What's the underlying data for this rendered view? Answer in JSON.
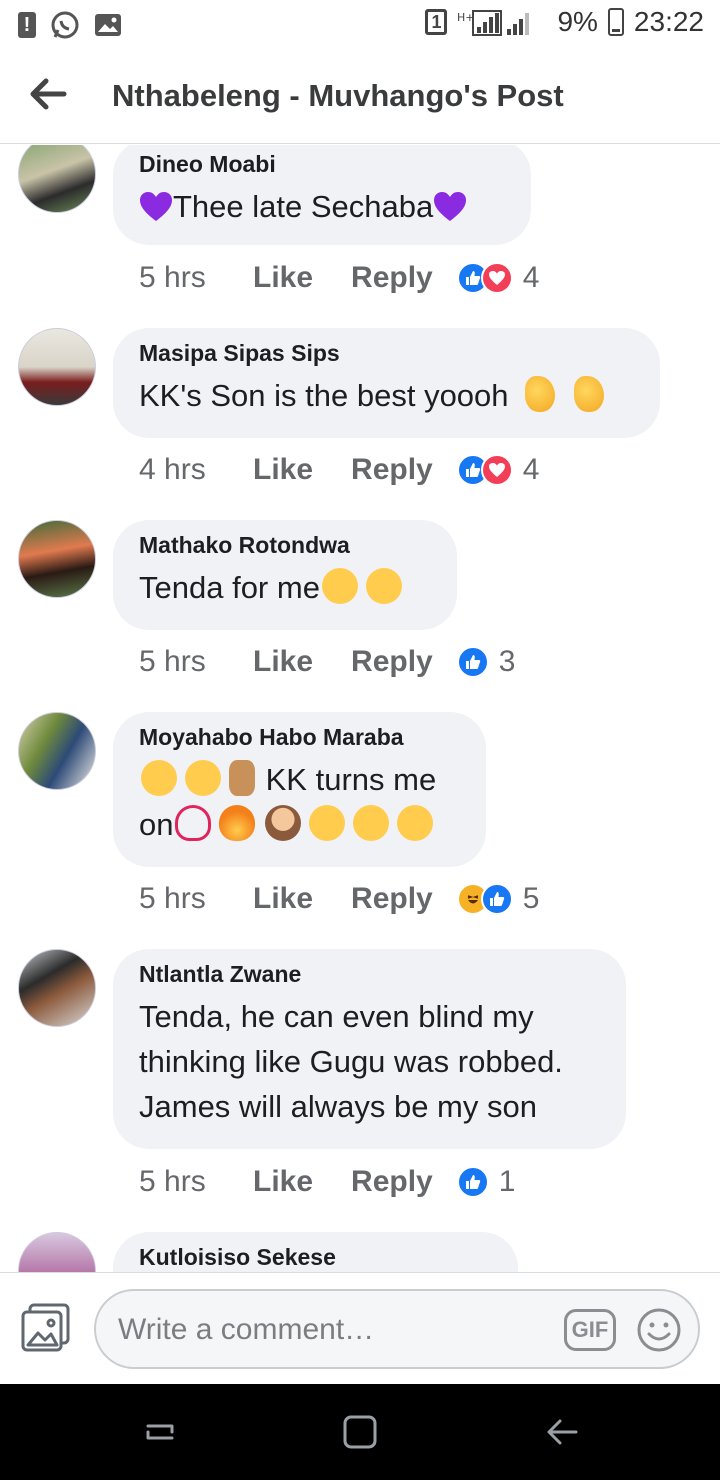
{
  "status_bar": {
    "notification_badge": "1",
    "battery": "9%",
    "time": "23:22"
  },
  "header": {
    "title": "Nthabeleng - Muvhango's Post"
  },
  "comments": [
    {
      "name": "Dineo Moabi",
      "text": "Thee late Sechaba",
      "time": "5 hrs",
      "like": "Like",
      "reply": "Reply",
      "reaction_icons": [
        "like",
        "love"
      ],
      "reaction_count": "4"
    },
    {
      "name": "Masipa Sipas Sips",
      "text": "KK's Son is the best yoooh",
      "time": "4 hrs",
      "like": "Like",
      "reply": "Reply",
      "reaction_icons": [
        "like",
        "love"
      ],
      "reaction_count": "4"
    },
    {
      "name": "Mathako Rotondwa",
      "text": "Tenda for me",
      "time": "5 hrs",
      "like": "Like",
      "reply": "Reply",
      "reaction_icons": [
        "like"
      ],
      "reaction_count": "3"
    },
    {
      "name": "Moyahabo Habo Maraba",
      "text_line1": "KK turns me",
      "text_line2": "on",
      "time": "5 hrs",
      "like": "Like",
      "reply": "Reply",
      "reaction_icons": [
        "haha",
        "like"
      ],
      "reaction_count": "5"
    },
    {
      "name": "Ntlantla Zwane",
      "text_lines": [
        "Tenda, he can even blind my",
        "thinking like Gugu was robbed.",
        "James will always be my son"
      ],
      "time": "5 hrs",
      "like": "Like",
      "reply": "Reply",
      "reaction_icons": [
        "like"
      ],
      "reaction_count": "1"
    },
    {
      "name": "Kutloisiso Sekese"
    }
  ],
  "composer": {
    "placeholder": "Write a comment…",
    "gif_label": "GIF"
  },
  "colors": {
    "like_blue": "#1877f2",
    "love_red": "#f33e58",
    "haha_yellow": "#f7b125",
    "bubble_gray": "#f0f2f5",
    "heart_purple": "#8a2be2"
  }
}
